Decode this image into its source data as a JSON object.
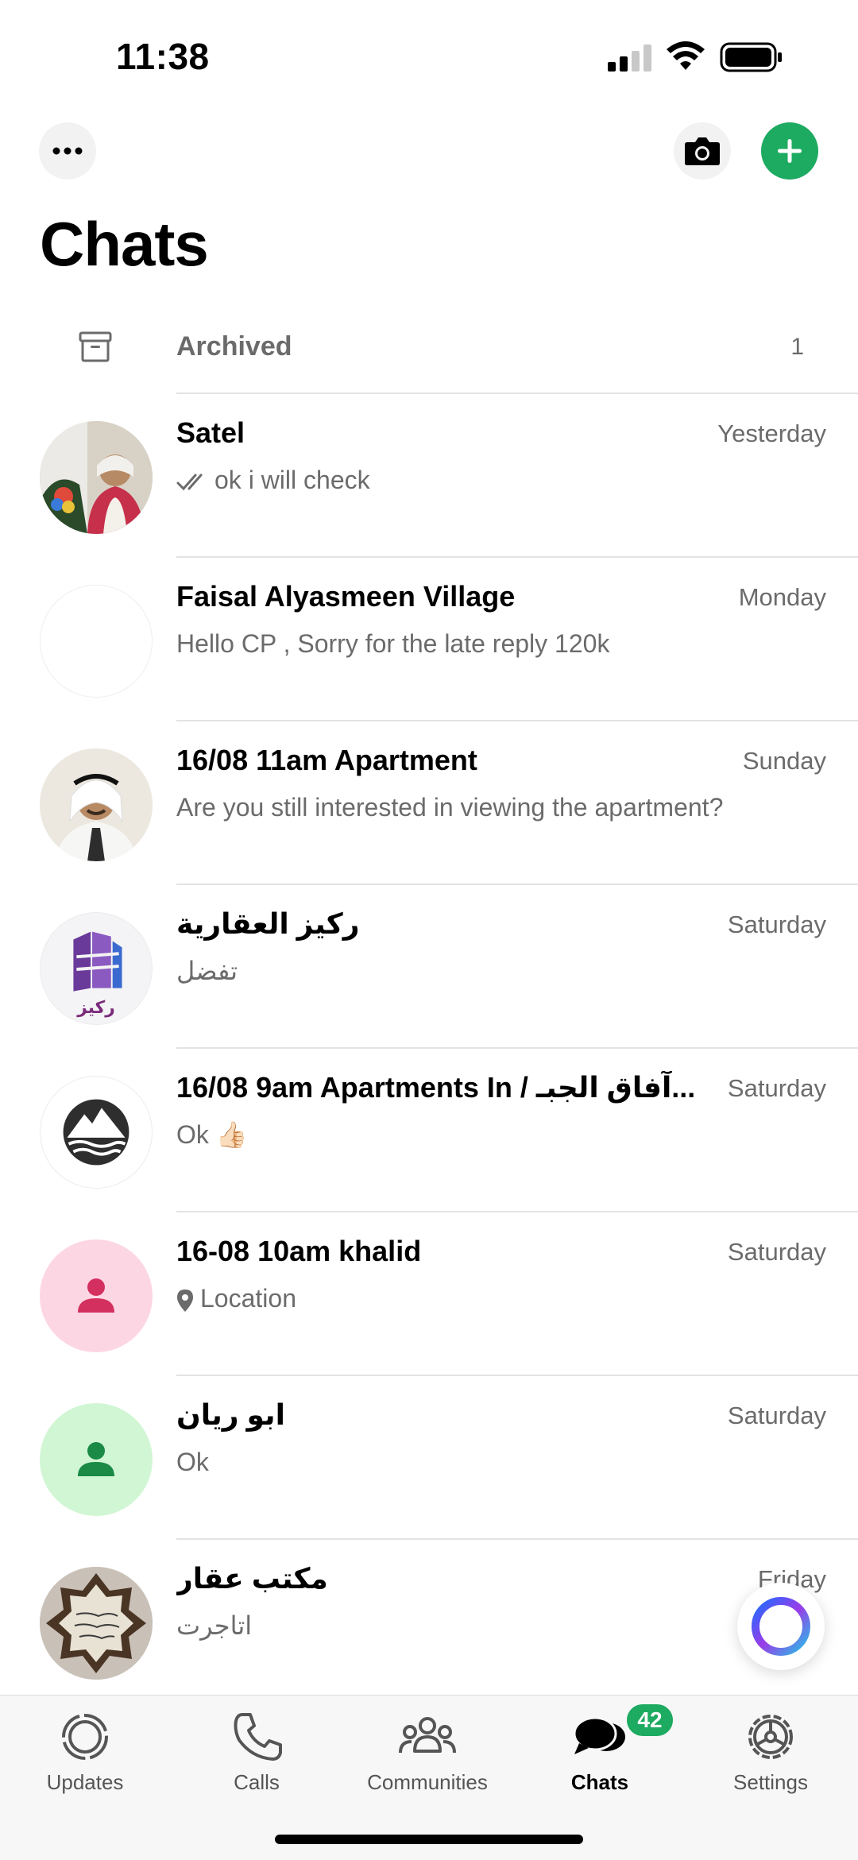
{
  "status_bar": {
    "time": "11:38"
  },
  "header": {
    "title": "Chats",
    "more_icon": "ellipsis-icon",
    "camera_icon": "camera-icon",
    "new_chat_icon": "plus-icon",
    "accent": "#1daa61"
  },
  "archived": {
    "label": "Archived",
    "count": "1"
  },
  "chats": [
    {
      "name": "Satel",
      "time": "Yesterday",
      "preview": "ok i will check",
      "read_receipt": "double-check-icon"
    },
    {
      "name": "Faisal Alyasmeen Village",
      "time": "Monday",
      "preview": "Hello CP , Sorry for the late reply 120k"
    },
    {
      "name": "16/08 11am Apartment",
      "time": "Sunday",
      "preview": "Are you still interested in viewing the apartment?"
    },
    {
      "name": "ركيز العقارية",
      "time": "Saturday",
      "preview": "تفضل"
    },
    {
      "name": "16/08 9am Apartments In / آفاق الجبـ...",
      "time": "Saturday",
      "preview": "Ok 👍🏻"
    },
    {
      "name": "16-08 10am khalid",
      "time": "Saturday",
      "preview": "Location",
      "preview_icon": "location-pin-icon"
    },
    {
      "name": "ابو ريان",
      "time": "Saturday",
      "preview": "Ok"
    },
    {
      "name": "مكتب عقار",
      "time": "Friday",
      "preview": "اتاجرت"
    }
  ],
  "avatar_logo_text": "Rakeez ركيز",
  "tabs": [
    {
      "label": "Updates",
      "icon": "updates-icon"
    },
    {
      "label": "Calls",
      "icon": "phone-icon"
    },
    {
      "label": "Communities",
      "icon": "communities-icon"
    },
    {
      "label": "Chats",
      "icon": "chats-icon",
      "active": true
    },
    {
      "label": "Settings",
      "icon": "gear-icon"
    }
  ],
  "chats_badge": "42"
}
